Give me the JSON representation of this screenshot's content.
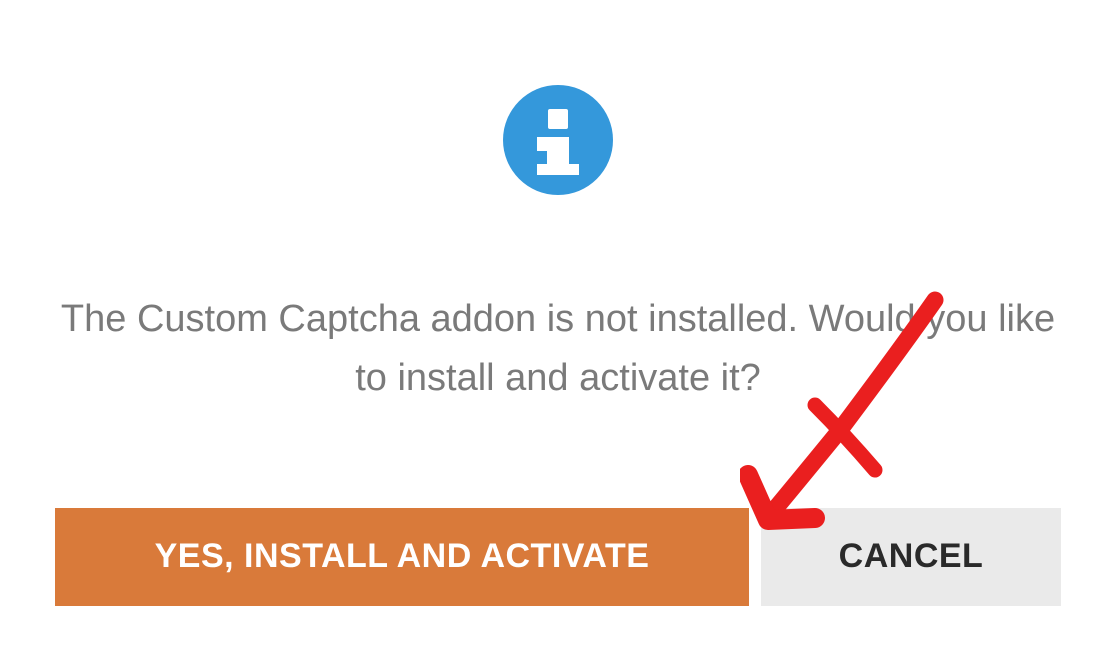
{
  "dialog": {
    "message": "The Custom Captcha addon is not installed. Would you like to install and activate it?",
    "buttons": {
      "confirm": "YES, INSTALL AND ACTIVATE",
      "cancel": "CANCEL"
    }
  },
  "colors": {
    "icon_bg": "#3498db",
    "primary_button": "#d97a3a",
    "secondary_button": "#eaeaea",
    "text_muted": "#7a7a7a",
    "annotation": "#ea1f1f"
  }
}
